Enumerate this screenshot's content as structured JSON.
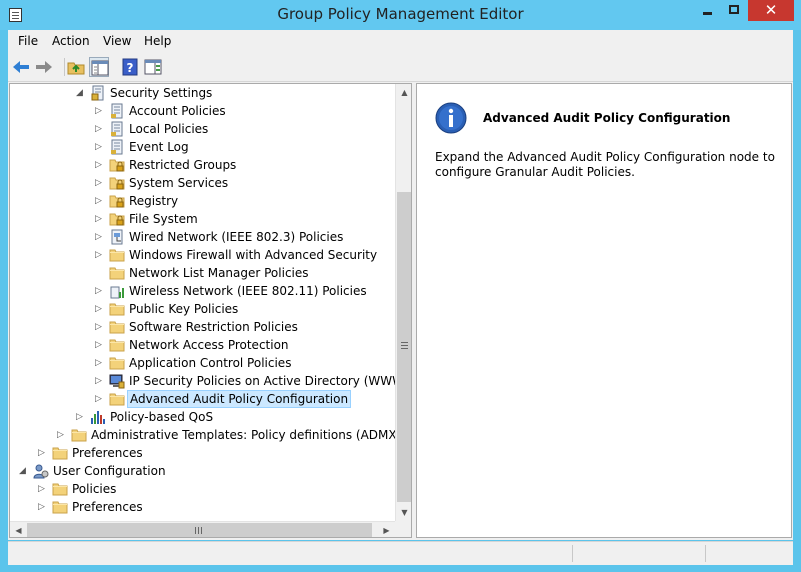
{
  "window": {
    "title": "Group Policy Management Editor",
    "close_glyph": "✕"
  },
  "menu": {
    "file": "File",
    "action": "Action",
    "view": "View",
    "help": "Help"
  },
  "toolbar": {
    "icons": [
      "back-arrow-icon",
      "forward-arrow-icon",
      "up-folder-icon",
      "show-hide-tree-icon",
      "help-icon",
      "show-hide-action-pane-icon"
    ]
  },
  "tree": {
    "items": [
      {
        "label": "Security Settings",
        "expander": "◢",
        "icon": "security-shield-icon"
      },
      {
        "label": "Account Policies",
        "expander": "▷",
        "icon": "policy-document-icon"
      },
      {
        "label": "Local Policies",
        "expander": "▷",
        "icon": "policy-document-icon"
      },
      {
        "label": "Event Log",
        "expander": "▷",
        "icon": "policy-document-icon"
      },
      {
        "label": "Restricted Groups",
        "expander": "▷",
        "icon": "locked-folder-icon"
      },
      {
        "label": "System Services",
        "expander": "▷",
        "icon": "locked-folder-icon"
      },
      {
        "label": "Registry",
        "expander": "▷",
        "icon": "locked-folder-icon"
      },
      {
        "label": "File System",
        "expander": "▷",
        "icon": "locked-folder-icon"
      },
      {
        "label": "Wired Network (IEEE 802.3) Policies",
        "expander": "▷",
        "icon": "wired-network-icon"
      },
      {
        "label": "Windows Firewall with Advanced Security",
        "expander": "▷",
        "icon": "folder-icon"
      },
      {
        "label": "Network List Manager Policies",
        "expander": "",
        "icon": "folder-icon"
      },
      {
        "label": "Wireless Network (IEEE 802.11) Policies",
        "expander": "▷",
        "icon": "wireless-network-icon"
      },
      {
        "label": "Public Key Policies",
        "expander": "▷",
        "icon": "folder-icon"
      },
      {
        "label": "Software Restriction Policies",
        "expander": "▷",
        "icon": "folder-icon"
      },
      {
        "label": "Network Access Protection",
        "expander": "▷",
        "icon": "folder-icon"
      },
      {
        "label": "Application Control Policies",
        "expander": "▷",
        "icon": "folder-icon"
      },
      {
        "label": "IP Security Policies on Active Directory (WWW.ABC",
        "expander": "▷",
        "icon": "ip-security-icon"
      },
      {
        "label": "Advanced Audit Policy Configuration",
        "expander": "▷",
        "icon": "folder-icon",
        "selected": true
      },
      {
        "label": "Policy-based QoS",
        "expander": "▷",
        "icon": "qos-chart-icon"
      },
      {
        "label": "Administrative Templates: Policy definitions (ADMX files)",
        "expander": "▷",
        "icon": "folder-icon"
      },
      {
        "label": "Preferences",
        "expander": "▷",
        "icon": "folder-icon"
      },
      {
        "label": "User Configuration",
        "expander": "◢",
        "icon": "user-configuration-icon"
      },
      {
        "label": "Policies",
        "expander": "▷",
        "icon": "folder-icon"
      },
      {
        "label": "Preferences",
        "expander": "▷",
        "icon": "folder-icon"
      }
    ]
  },
  "scroll": {
    "up": "▲",
    "down": "▼",
    "left": "◀",
    "right": "▶"
  },
  "detail": {
    "icon": "info-icon",
    "title": "Advanced Audit Policy Configuration",
    "body": "Expand the Advanced Audit Policy Configuration node to configure Granular Audit Policies."
  }
}
